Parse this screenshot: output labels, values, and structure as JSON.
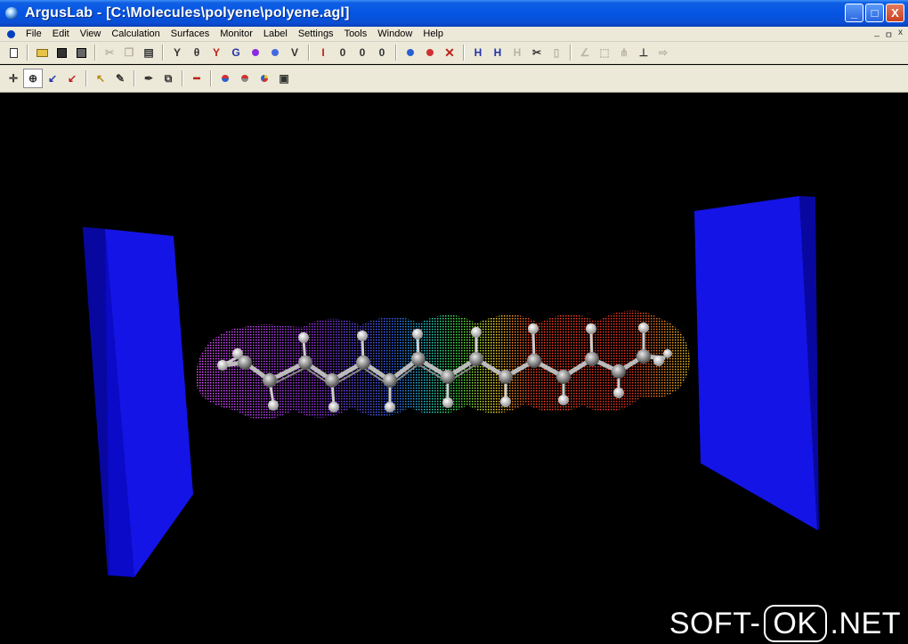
{
  "window": {
    "title": "ArgusLab - [C:\\Molecules\\polyene\\polyene.agl]",
    "controls": {
      "minimize": "_",
      "maximize": "□",
      "close": "X"
    }
  },
  "menu": {
    "items": [
      "File",
      "Edit",
      "View",
      "Calculation",
      "Surfaces",
      "Monitor",
      "Label",
      "Settings",
      "Tools",
      "Window",
      "Help"
    ],
    "mdi_controls": [
      "_",
      "ㅁ",
      "x"
    ]
  },
  "toolbar1": {
    "icons": [
      "new-doc-icon",
      "open-folder-icon",
      "save-icon",
      "save-all-icon",
      "cut-icon",
      "copy-icon",
      "paste-icon",
      "Y",
      "θ",
      "Y",
      "G",
      "build-icon",
      "build2-icon",
      "V",
      "I",
      "0",
      "0",
      "0",
      "atom-icon",
      "bond-icon",
      "delete-icon",
      "H",
      "H",
      "H",
      "scissors-icon",
      "trash-icon",
      "angle-icon",
      "box-icon",
      "dihedral-icon",
      "axes-icon",
      "arrow-icon"
    ]
  },
  "toolbar2": {
    "icons": [
      "move-icon",
      "rotate-icon",
      "select-icon",
      "select2-icon",
      "pointer-icon",
      "pencil-icon",
      "pen-icon",
      "clip-icon",
      "minus-icon",
      "atom-red-blue-icon",
      "atom-red-icon",
      "pie-icon",
      "cube-icon"
    ]
  },
  "colors": {
    "titlebar": "#0554e3",
    "plate": "#1010e0",
    "background": "#000000"
  },
  "watermark": {
    "left": "SOFT-",
    "mid": "OK",
    "right": ".NET"
  }
}
